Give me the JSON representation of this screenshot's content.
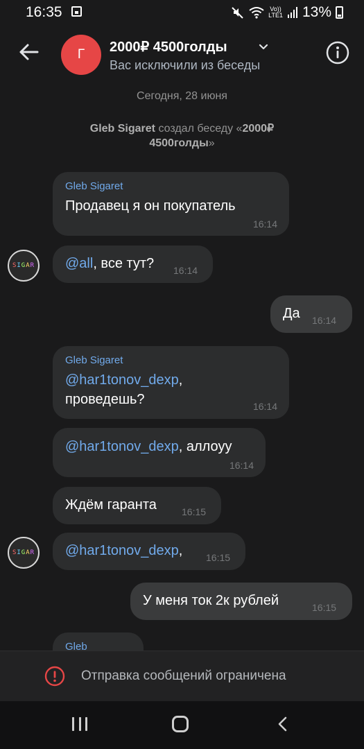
{
  "status_bar": {
    "time": "16:35",
    "volte_top": "Vo))",
    "volte_bottom": "LTE1",
    "battery": "13%"
  },
  "header": {
    "avatar_letter": "Г",
    "title": "2000₽ 4500голды",
    "subtitle": "Вас исключили из беседы"
  },
  "chat": {
    "date_separator": "Сегодня, 28 июня",
    "service_message": {
      "author": "Gleb Sigaret",
      "text_before": " создал беседу «",
      "chat_name": "2000₽ 4500голды",
      "text_after": "»"
    },
    "avatar_text": [
      "S",
      "I",
      "G",
      "A",
      "R"
    ],
    "messages": [
      {
        "sender": "Gleb Sigaret",
        "text": "Продавец я он покупатель",
        "time": "16:14"
      },
      {
        "mention": "@all",
        "text": ", все тут?",
        "time": "16:14"
      },
      {
        "text": "Да",
        "time": "16:14"
      },
      {
        "sender": "Gleb Sigaret",
        "mention": "@har1tonov_dexp",
        "text_inline": ",",
        "text_line2": "проведешь?",
        "time": "16:14"
      },
      {
        "mention": "@har1tonov_dexp",
        "text": ", аллоуу",
        "time": "16:14"
      },
      {
        "text": "Ждём гаранта",
        "time": "16:15"
      },
      {
        "mention": "@har1tonov_dexp",
        "text": ",",
        "time": "16:15"
      },
      {
        "text": "У меня ток 2к рублей",
        "time": "16:15"
      },
      {
        "sender": "Gleb"
      }
    ]
  },
  "restricted": {
    "text": "Отправка сообщений ограничена"
  },
  "colors": {
    "background": "#1a1a1b",
    "incoming_bubble": "#2c2d2e",
    "outgoing_bubble": "#3a3b3c",
    "accent": "#71aaeb",
    "avatar": "#e64646",
    "warning": "#e64646"
  },
  "icons": [
    "back-arrow-icon",
    "chevron-down-icon",
    "info-icon",
    "warning-icon",
    "nav-recents-icon",
    "nav-home-icon",
    "nav-back-icon",
    "mute-icon",
    "wifi-icon",
    "signal-icon",
    "battery-icon"
  ]
}
